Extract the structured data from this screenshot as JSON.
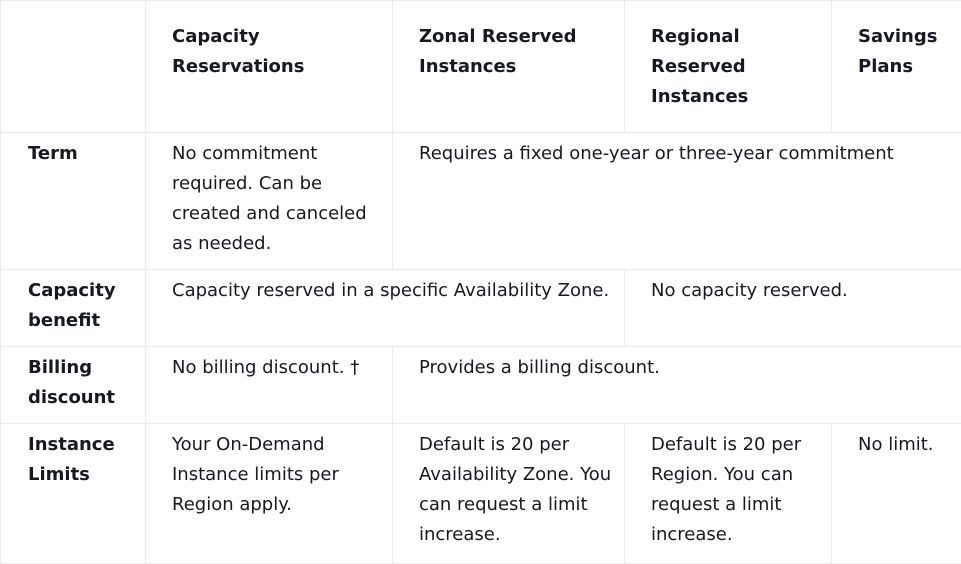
{
  "headers": {
    "blank": "",
    "capacity_reservations": "Capacity Reservations",
    "zonal_reserved_instances": "Zonal Reserved Instances",
    "regional_reserved_instances": "Regional Reserved Instances",
    "savings_plans": "Savings Plans"
  },
  "rows": {
    "term": {
      "label": "Term",
      "capacity_reservations": "No commitment required. Can be created and canceled as needed.",
      "others": "Requires a fixed one-year or three-year commitment"
    },
    "capacity_benefit": {
      "label": "Capacity benefit",
      "zonal": "Capacity reserved in a specific Availability Zone.",
      "non_zonal": "No capacity reserved."
    },
    "billing_discount": {
      "label": "Billing discount",
      "capacity_reservations": "No billing discount. †",
      "others": "Provides a billing discount."
    },
    "instance_limits": {
      "label": "Instance Limits",
      "capacity_reservations": "Your On-Demand Instance limits per Region apply.",
      "zonal_reserved_instances": "Default is 20 per Availability Zone. You can request a limit increase.",
      "regional_reserved_instances": "Default is 20 per Region. You can request a limit increase.",
      "savings_plans": "No limit."
    }
  }
}
